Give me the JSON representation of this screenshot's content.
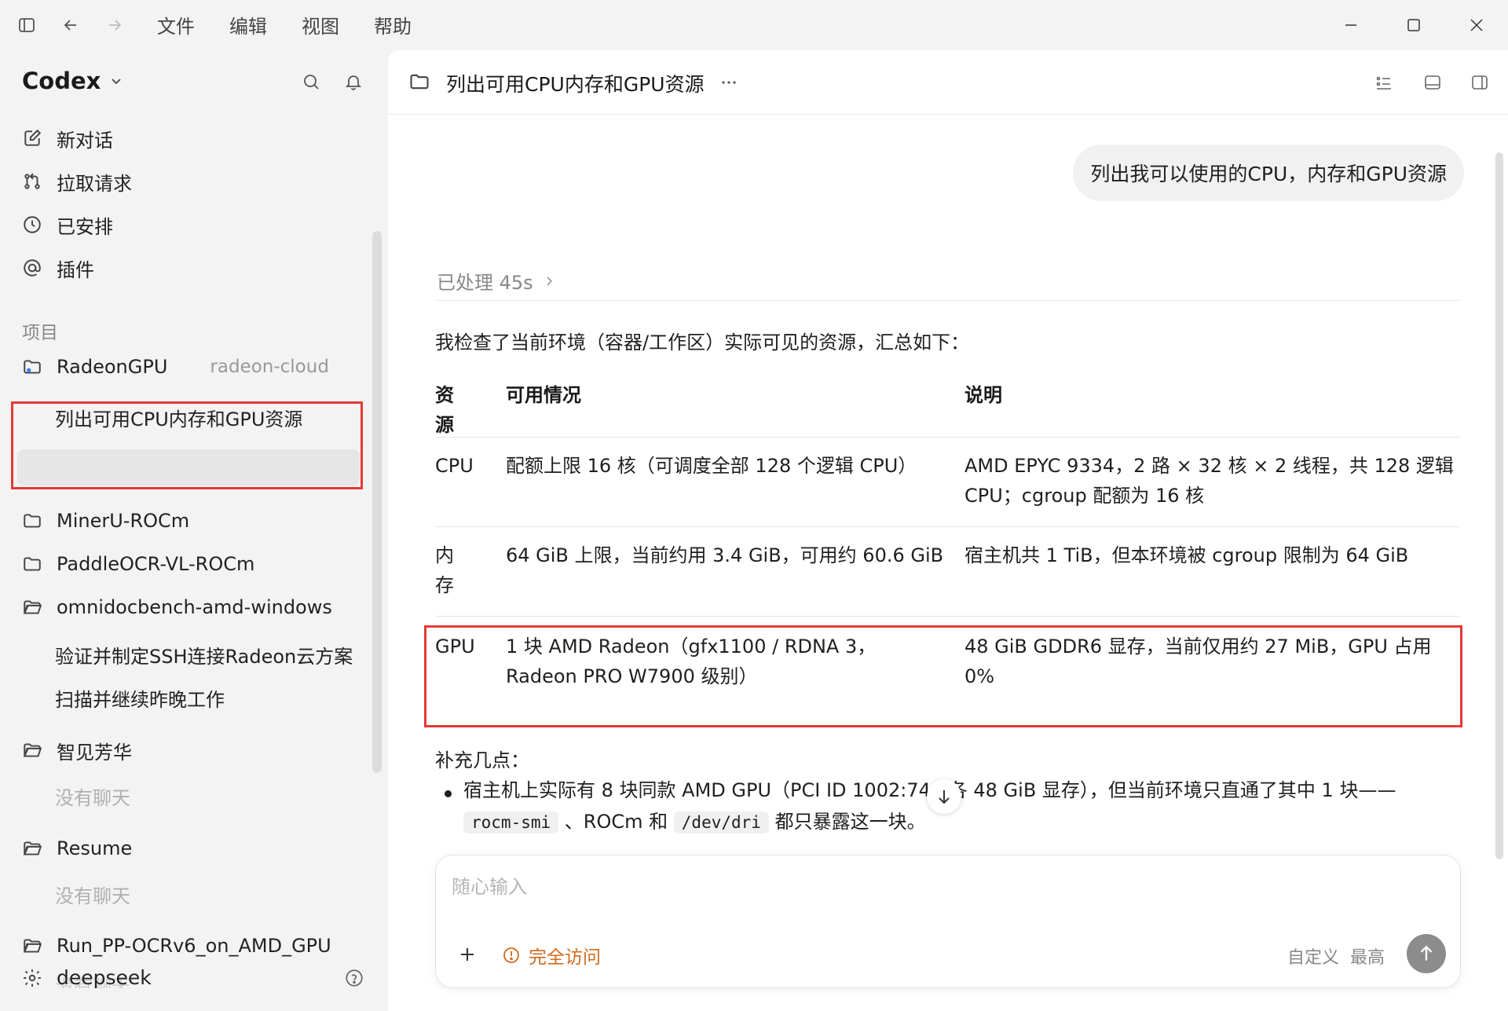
{
  "menu": {
    "file": "文件",
    "edit": "编辑",
    "view": "视图",
    "help": "帮助"
  },
  "sidebar": {
    "app_name": "Codex",
    "nav": {
      "new_chat": "新对话",
      "pull_requests": "拉取请求",
      "scheduled": "已安排",
      "plugins": "插件"
    },
    "section_projects": "项目",
    "projects": [
      {
        "name": "RadeonGPU",
        "tag": "radeon-cloud",
        "status_color": "#34a853",
        "threads": [
          "列出可用CPU内存和GPU资源"
        ]
      },
      {
        "name": "MinerU-ROCm",
        "threads": []
      },
      {
        "name": "PaddleOCR-VL-ROCm",
        "threads": []
      },
      {
        "name": "omnidocbench-amd-windows",
        "threads": [
          "验证并制定SSH连接Radeon云方案",
          "扫描并继续昨晚工作"
        ]
      },
      {
        "name": "智见芳华",
        "threads": [],
        "empty": "没有聊天"
      },
      {
        "name": "Resume",
        "threads": [],
        "empty": "没有聊天"
      },
      {
        "name": "Run_PP-OCRv6_on_AMD_GPU",
        "threads": [],
        "empty": "没有聊天"
      }
    ],
    "footer_user": "deepseek"
  },
  "conversation": {
    "title": "列出可用CPU内存和GPU资源",
    "user_message": "列出我可以使用的CPU，内存和GPU资源",
    "processed": "已处理 45s",
    "intro": "我检查了当前环境（容器/工作区）实际可见的资源，汇总如下：",
    "table": {
      "headers": [
        "资\n源",
        "可用情况",
        "说明"
      ],
      "rows": [
        {
          "resource": "CPU",
          "availability": "配额上限 16 核（可调度全部 128 个逻辑 CPU）",
          "note": "AMD EPYC 9334，2 路 × 32 核 × 2 线程，共 128 逻辑 CPU；cgroup 配额为 16 核"
        },
        {
          "resource": "内\n存",
          "availability": "64 GiB 上限，当前约用 3.4 GiB，可用约 60.6 GiB",
          "note": "宿主机共 1 TiB，但本环境被 cgroup 限制为 64 GiB"
        },
        {
          "resource": "GPU",
          "availability": "1 块 AMD Radeon（gfx1100 / RDNA 3，Radeon PRO W7900 级别）",
          "note": "48 GiB GDDR6 显存，当前仅用约 27 MiB，GPU 占用 0%"
        }
      ]
    },
    "supplement_label": "补充几点：",
    "bullet": {
      "part1": "宿主机上实际有 8 块同款 AMD GPU（PCI ID 1002:744",
      "part2": "各 48 GiB 显存），但当前环境只直通了其中 1 块——",
      "code1": "rocm-smi",
      "sep1": "、ROCm 和",
      "code2": "/dev/dri",
      "part3": "都只暴露这一块。"
    }
  },
  "composer": {
    "placeholder": "随心输入",
    "access_label": "完全访问",
    "mode": "自定义",
    "level": "最高"
  },
  "colors": {
    "highlight": "#e53935",
    "access": "#d2691e",
    "status_online": "#34a853"
  }
}
